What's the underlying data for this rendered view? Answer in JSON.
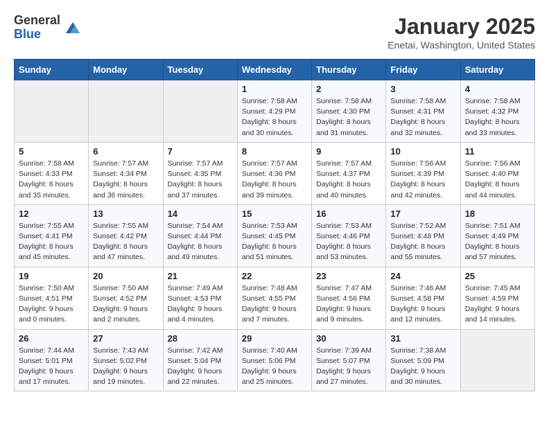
{
  "header": {
    "logo_general": "General",
    "logo_blue": "Blue",
    "month_title": "January 2025",
    "location": "Enetai, Washington, United States"
  },
  "days_of_week": [
    "Sunday",
    "Monday",
    "Tuesday",
    "Wednesday",
    "Thursday",
    "Friday",
    "Saturday"
  ],
  "weeks": [
    [
      {
        "num": "",
        "info": ""
      },
      {
        "num": "",
        "info": ""
      },
      {
        "num": "",
        "info": ""
      },
      {
        "num": "1",
        "info": "Sunrise: 7:58 AM\nSunset: 4:29 PM\nDaylight: 8 hours\nand 30 minutes."
      },
      {
        "num": "2",
        "info": "Sunrise: 7:58 AM\nSunset: 4:30 PM\nDaylight: 8 hours\nand 31 minutes."
      },
      {
        "num": "3",
        "info": "Sunrise: 7:58 AM\nSunset: 4:31 PM\nDaylight: 8 hours\nand 32 minutes."
      },
      {
        "num": "4",
        "info": "Sunrise: 7:58 AM\nSunset: 4:32 PM\nDaylight: 8 hours\nand 33 minutes."
      }
    ],
    [
      {
        "num": "5",
        "info": "Sunrise: 7:58 AM\nSunset: 4:33 PM\nDaylight: 8 hours\nand 35 minutes."
      },
      {
        "num": "6",
        "info": "Sunrise: 7:57 AM\nSunset: 4:34 PM\nDaylight: 8 hours\nand 36 minutes."
      },
      {
        "num": "7",
        "info": "Sunrise: 7:57 AM\nSunset: 4:35 PM\nDaylight: 8 hours\nand 37 minutes."
      },
      {
        "num": "8",
        "info": "Sunrise: 7:57 AM\nSunset: 4:36 PM\nDaylight: 8 hours\nand 39 minutes."
      },
      {
        "num": "9",
        "info": "Sunrise: 7:57 AM\nSunset: 4:37 PM\nDaylight: 8 hours\nand 40 minutes."
      },
      {
        "num": "10",
        "info": "Sunrise: 7:56 AM\nSunset: 4:39 PM\nDaylight: 8 hours\nand 42 minutes."
      },
      {
        "num": "11",
        "info": "Sunrise: 7:56 AM\nSunset: 4:40 PM\nDaylight: 8 hours\nand 44 minutes."
      }
    ],
    [
      {
        "num": "12",
        "info": "Sunrise: 7:55 AM\nSunset: 4:41 PM\nDaylight: 8 hours\nand 45 minutes."
      },
      {
        "num": "13",
        "info": "Sunrise: 7:55 AM\nSunset: 4:42 PM\nDaylight: 8 hours\nand 47 minutes."
      },
      {
        "num": "14",
        "info": "Sunrise: 7:54 AM\nSunset: 4:44 PM\nDaylight: 8 hours\nand 49 minutes."
      },
      {
        "num": "15",
        "info": "Sunrise: 7:53 AM\nSunset: 4:45 PM\nDaylight: 8 hours\nand 51 minutes."
      },
      {
        "num": "16",
        "info": "Sunrise: 7:53 AM\nSunset: 4:46 PM\nDaylight: 8 hours\nand 53 minutes."
      },
      {
        "num": "17",
        "info": "Sunrise: 7:52 AM\nSunset: 4:48 PM\nDaylight: 8 hours\nand 55 minutes."
      },
      {
        "num": "18",
        "info": "Sunrise: 7:51 AM\nSunset: 4:49 PM\nDaylight: 8 hours\nand 57 minutes."
      }
    ],
    [
      {
        "num": "19",
        "info": "Sunrise: 7:50 AM\nSunset: 4:51 PM\nDaylight: 9 hours\nand 0 minutes."
      },
      {
        "num": "20",
        "info": "Sunrise: 7:50 AM\nSunset: 4:52 PM\nDaylight: 9 hours\nand 2 minutes."
      },
      {
        "num": "21",
        "info": "Sunrise: 7:49 AM\nSunset: 4:53 PM\nDaylight: 9 hours\nand 4 minutes."
      },
      {
        "num": "22",
        "info": "Sunrise: 7:48 AM\nSunset: 4:55 PM\nDaylight: 9 hours\nand 7 minutes."
      },
      {
        "num": "23",
        "info": "Sunrise: 7:47 AM\nSunset: 4:56 PM\nDaylight: 9 hours\nand 9 minutes."
      },
      {
        "num": "24",
        "info": "Sunrise: 7:46 AM\nSunset: 4:58 PM\nDaylight: 9 hours\nand 12 minutes."
      },
      {
        "num": "25",
        "info": "Sunrise: 7:45 AM\nSunset: 4:59 PM\nDaylight: 9 hours\nand 14 minutes."
      }
    ],
    [
      {
        "num": "26",
        "info": "Sunrise: 7:44 AM\nSunset: 5:01 PM\nDaylight: 9 hours\nand 17 minutes."
      },
      {
        "num": "27",
        "info": "Sunrise: 7:43 AM\nSunset: 5:02 PM\nDaylight: 9 hours\nand 19 minutes."
      },
      {
        "num": "28",
        "info": "Sunrise: 7:42 AM\nSunset: 5:04 PM\nDaylight: 9 hours\nand 22 minutes."
      },
      {
        "num": "29",
        "info": "Sunrise: 7:40 AM\nSunset: 5:06 PM\nDaylight: 9 hours\nand 25 minutes."
      },
      {
        "num": "30",
        "info": "Sunrise: 7:39 AM\nSunset: 5:07 PM\nDaylight: 9 hours\nand 27 minutes."
      },
      {
        "num": "31",
        "info": "Sunrise: 7:38 AM\nSunset: 5:09 PM\nDaylight: 9 hours\nand 30 minutes."
      },
      {
        "num": "",
        "info": ""
      }
    ]
  ]
}
